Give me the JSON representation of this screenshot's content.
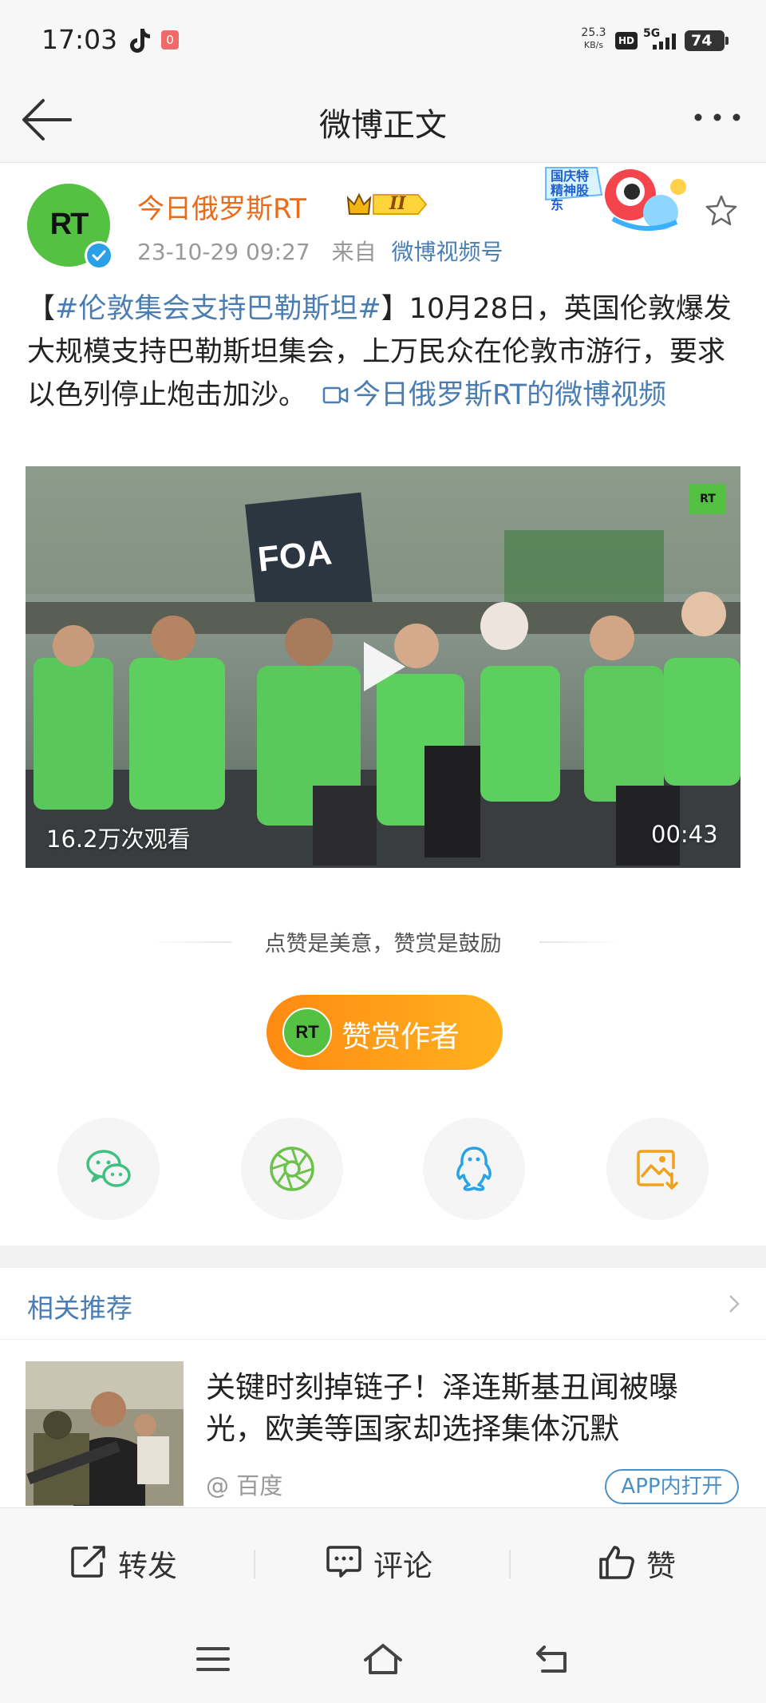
{
  "status_bar": {
    "time": "17:03",
    "notification_count": "0",
    "net_speed": "25.3",
    "net_speed_unit": "KB/s",
    "hd_label": "HD",
    "signal_label": "5G",
    "battery": "74"
  },
  "nav": {
    "title": "微博正文"
  },
  "post": {
    "avatar_text": "RT",
    "username": "今日俄罗斯RT",
    "vip_level": "II",
    "date": "23-10-29 09:27",
    "source_prefix": "来自",
    "source": "微博视频号",
    "promo_badge_text": "国庆特\n精神股东",
    "text_prefix": "【",
    "topic": "#伦敦集会支持巴勒斯坦#",
    "text_body": "】10月28日，英国伦敦爆发大规模支持巴勒斯坦集会，上万民众在伦敦市游行，要求以色列停止炮击加沙。",
    "video_link": "今日俄罗斯RT的微博视频",
    "video": {
      "view_count": "16.2万次观看",
      "duration": "00:43",
      "watermark": "RT",
      "banner_text": "FOA"
    }
  },
  "reward": {
    "caption": "点赞是美意，赞赏是鼓励",
    "button_label": "赞赏作者",
    "avatar_text": "RT"
  },
  "share": {
    "icons": [
      "wechat-icon",
      "moments-icon",
      "qq-icon",
      "save-image-icon"
    ]
  },
  "related": {
    "title": "相关推荐",
    "item": {
      "headline": "关键时刻掉链子！泽连斯基丑闻被曝光，欧美等国家却选择集体沉默",
      "source": "@ 百度",
      "open_label": "APP内打开"
    }
  },
  "actions": {
    "repost": "转发",
    "comment": "评论",
    "like": "赞"
  },
  "colors": {
    "link": "#4a7eb3",
    "username": "#e96c1c",
    "reward_gradient_start": "#ff8a12",
    "reward_gradient_end": "#ffb21f",
    "rt_green": "#54c142"
  }
}
